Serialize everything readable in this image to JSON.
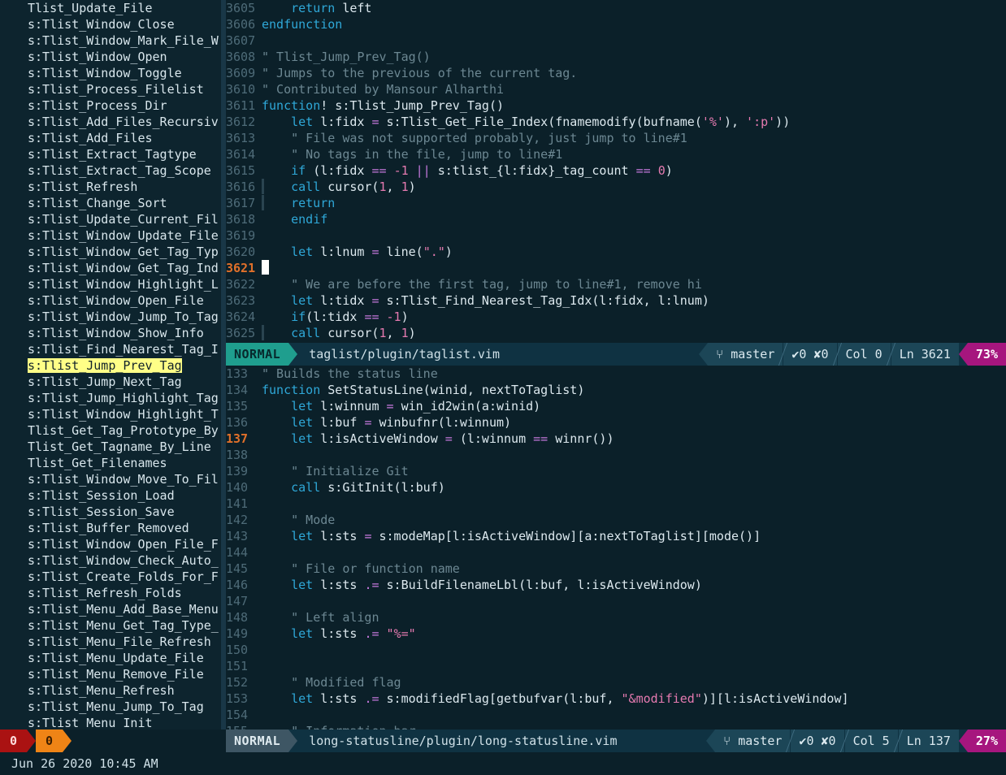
{
  "app": {
    "theme_bg": "#0b2029",
    "accent": "#1f9e8e",
    "highlight": "#ffff87",
    "percent_bg": "#a6167e"
  },
  "sidebar": {
    "name": "taglist",
    "scrollbar": {
      "name": "sidebar-scrollbar"
    },
    "selected_item": "s:Tlist_Jump_Prev_Tag",
    "items": [
      {
        "label": "Tlist_Update_File",
        "selected": false
      },
      {
        "label": "s:Tlist_Window_Close",
        "selected": false
      },
      {
        "label": "s:Tlist_Window_Mark_File_W",
        "selected": false
      },
      {
        "label": "s:Tlist_Window_Open",
        "selected": false
      },
      {
        "label": "s:Tlist_Window_Toggle",
        "selected": false
      },
      {
        "label": "s:Tlist_Process_Filelist",
        "selected": false
      },
      {
        "label": "s:Tlist_Process_Dir",
        "selected": false
      },
      {
        "label": "s:Tlist_Add_Files_Recursiv",
        "selected": false
      },
      {
        "label": "s:Tlist_Add_Files",
        "selected": false
      },
      {
        "label": "s:Tlist_Extract_Tagtype",
        "selected": false
      },
      {
        "label": "s:Tlist_Extract_Tag_Scope",
        "selected": false
      },
      {
        "label": "s:Tlist_Refresh",
        "selected": false
      },
      {
        "label": "s:Tlist_Change_Sort",
        "selected": false
      },
      {
        "label": "s:Tlist_Update_Current_Fil",
        "selected": false
      },
      {
        "label": "s:Tlist_Window_Update_File",
        "selected": false
      },
      {
        "label": "s:Tlist_Window_Get_Tag_Typ",
        "selected": false
      },
      {
        "label": "s:Tlist_Window_Get_Tag_Ind",
        "selected": false
      },
      {
        "label": "s:Tlist_Window_Highlight_L",
        "selected": false
      },
      {
        "label": "s:Tlist_Window_Open_File",
        "selected": false
      },
      {
        "label": "s:Tlist_Window_Jump_To_Tag",
        "selected": false
      },
      {
        "label": "s:Tlist_Window_Show_Info",
        "selected": false
      },
      {
        "label": "s:Tlist_Find_Nearest_Tag_I",
        "selected": false
      },
      {
        "label": "s:Tlist_Jump_Prev_Tag",
        "selected": true
      },
      {
        "label": "s:Tlist_Jump_Next_Tag",
        "selected": false
      },
      {
        "label": "s:Tlist_Jump_Highlight_Tag",
        "selected": false
      },
      {
        "label": "s:Tlist_Window_Highlight_T",
        "selected": false
      },
      {
        "label": "Tlist_Get_Tag_Prototype_By",
        "selected": false
      },
      {
        "label": "Tlist_Get_Tagname_By_Line",
        "selected": false
      },
      {
        "label": "Tlist_Get_Filenames",
        "selected": false
      },
      {
        "label": "s:Tlist_Window_Move_To_Fil",
        "selected": false
      },
      {
        "label": "s:Tlist_Session_Load",
        "selected": false
      },
      {
        "label": "s:Tlist_Session_Save",
        "selected": false
      },
      {
        "label": "s:Tlist_Buffer_Removed",
        "selected": false
      },
      {
        "label": "s:Tlist_Window_Open_File_F",
        "selected": false
      },
      {
        "label": "s:Tlist_Window_Check_Auto_",
        "selected": false
      },
      {
        "label": "s:Tlist_Create_Folds_For_F",
        "selected": false
      },
      {
        "label": "s:Tlist_Refresh_Folds",
        "selected": false
      },
      {
        "label": "s:Tlist_Menu_Add_Base_Menu",
        "selected": false
      },
      {
        "label": "s:Tlist_Menu_Get_Tag_Type_",
        "selected": false
      },
      {
        "label": "s:Tlist_Menu_File_Refresh",
        "selected": false
      },
      {
        "label": "s:Tlist_Menu_Update_File",
        "selected": false
      },
      {
        "label": "s:Tlist_Menu_Remove_File",
        "selected": false
      },
      {
        "label": "s:Tlist_Menu_Refresh",
        "selected": false
      },
      {
        "label": "s:Tlist_Menu_Jump_To_Tag",
        "selected": false
      },
      {
        "label": "s:Tlist_Menu_Init",
        "selected": false
      }
    ]
  },
  "top_pane": {
    "cursor_line": 3621,
    "lines": [
      {
        "n": "3605",
        "tokens": [
          {
            "t": "    ",
            "c": "pl"
          },
          {
            "t": "return",
            "c": "k"
          },
          {
            "t": " left",
            "c": "id"
          }
        ]
      },
      {
        "n": "3606",
        "tokens": [
          {
            "t": "endfunction",
            "c": "k"
          }
        ]
      },
      {
        "n": "3607",
        "tokens": []
      },
      {
        "n": "3608",
        "tokens": [
          {
            "t": "\" Tlist_Jump_Prev_Tag()",
            "c": "cm"
          }
        ]
      },
      {
        "n": "3609",
        "tokens": [
          {
            "t": "\" Jumps to the previous of the current tag.",
            "c": "cm"
          }
        ]
      },
      {
        "n": "3610",
        "tokens": [
          {
            "t": "\" Contributed by Mansour Alharthi",
            "c": "cm"
          }
        ]
      },
      {
        "n": "3611",
        "tokens": [
          {
            "t": "function",
            "c": "k"
          },
          {
            "t": "! s:Tlist_Jump_Prev_Tag()",
            "c": "id"
          }
        ]
      },
      {
        "n": "3612",
        "tokens": [
          {
            "t": "    ",
            "c": "pl"
          },
          {
            "t": "let",
            "c": "k"
          },
          {
            "t": " l:fidx ",
            "c": "id"
          },
          {
            "t": "=",
            "c": "op"
          },
          {
            "t": " s:Tlist_Get_File_Index(fnamemodify(bufname(",
            "c": "id"
          },
          {
            "t": "'%'",
            "c": "st"
          },
          {
            "t": "), ",
            "c": "id"
          },
          {
            "t": "':p'",
            "c": "st"
          },
          {
            "t": "))",
            "c": "id"
          }
        ]
      },
      {
        "n": "3613",
        "tokens": [
          {
            "t": "    ",
            "c": "pl"
          },
          {
            "t": "\" File was not supported probably, just jump to line#1",
            "c": "cm"
          }
        ]
      },
      {
        "n": "3614",
        "tokens": [
          {
            "t": "    ",
            "c": "pl"
          },
          {
            "t": "\" No tags in the file, jump to line#1",
            "c": "cm"
          }
        ]
      },
      {
        "n": "3615",
        "tokens": [
          {
            "t": "    ",
            "c": "pl"
          },
          {
            "t": "if",
            "c": "k"
          },
          {
            "t": " (l:fidx ",
            "c": "id"
          },
          {
            "t": "==",
            "c": "op"
          },
          {
            "t": " ",
            "c": "id"
          },
          {
            "t": "-1",
            "c": "nu"
          },
          {
            "t": " ",
            "c": "id"
          },
          {
            "t": "||",
            "c": "op"
          },
          {
            "t": " s:tlist_{l:fidx}_tag_count ",
            "c": "id"
          },
          {
            "t": "==",
            "c": "op"
          },
          {
            "t": " ",
            "c": "id"
          },
          {
            "t": "0",
            "c": "nu"
          },
          {
            "t": ")",
            "c": "id"
          }
        ]
      },
      {
        "n": "3616",
        "guide": true,
        "tokens": [
          {
            "t": "   ",
            "c": "pl"
          },
          {
            "t": "call",
            "c": "k"
          },
          {
            "t": " cursor(",
            "c": "id"
          },
          {
            "t": "1",
            "c": "nu"
          },
          {
            "t": ", ",
            "c": "id"
          },
          {
            "t": "1",
            "c": "nu"
          },
          {
            "t": ")",
            "c": "id"
          }
        ]
      },
      {
        "n": "3617",
        "guide": true,
        "tokens": [
          {
            "t": "   ",
            "c": "pl"
          },
          {
            "t": "return",
            "c": "k"
          }
        ]
      },
      {
        "n": "3618",
        "tokens": [
          {
            "t": "    ",
            "c": "pl"
          },
          {
            "t": "endif",
            "c": "k"
          }
        ]
      },
      {
        "n": "3619",
        "tokens": []
      },
      {
        "n": "3620",
        "tokens": [
          {
            "t": "    ",
            "c": "pl"
          },
          {
            "t": "let",
            "c": "k"
          },
          {
            "t": " l:lnum ",
            "c": "id"
          },
          {
            "t": "=",
            "c": "op"
          },
          {
            "t": " line(",
            "c": "id"
          },
          {
            "t": "\".\"",
            "c": "st"
          },
          {
            "t": ")",
            "c": "id"
          }
        ]
      },
      {
        "n": "3621",
        "cursor": true,
        "tokens": []
      },
      {
        "n": "3622",
        "tokens": [
          {
            "t": "    ",
            "c": "pl"
          },
          {
            "t": "\" We are before the first tag, jump to line#1, remove hi",
            "c": "cm"
          }
        ]
      },
      {
        "n": "3623",
        "tokens": [
          {
            "t": "    ",
            "c": "pl"
          },
          {
            "t": "let",
            "c": "k"
          },
          {
            "t": " l:tidx ",
            "c": "id"
          },
          {
            "t": "=",
            "c": "op"
          },
          {
            "t": " s:Tlist_Find_Nearest_Tag_Idx(l:fidx, l:lnum)",
            "c": "id"
          }
        ]
      },
      {
        "n": "3624",
        "tokens": [
          {
            "t": "    ",
            "c": "pl"
          },
          {
            "t": "if",
            "c": "k"
          },
          {
            "t": "(l:tidx ",
            "c": "id"
          },
          {
            "t": "==",
            "c": "op"
          },
          {
            "t": " ",
            "c": "id"
          },
          {
            "t": "-1",
            "c": "nu"
          },
          {
            "t": ")",
            "c": "id"
          }
        ]
      },
      {
        "n": "3625",
        "guide": true,
        "tokens": [
          {
            "t": "   ",
            "c": "pl"
          },
          {
            "t": "call",
            "c": "k"
          },
          {
            "t": " cursor(",
            "c": "id"
          },
          {
            "t": "1",
            "c": "nu"
          },
          {
            "t": ", ",
            "c": "id"
          },
          {
            "t": "1",
            "c": "nu"
          },
          {
            "t": ")",
            "c": "id"
          }
        ]
      }
    ]
  },
  "top_status": {
    "mode": "NORMAL",
    "file": "taglist/plugin/taglist.vim",
    "git_icon": "git-branch-icon",
    "branch": "master",
    "ok_icon": "check-icon",
    "ok_count": "0",
    "err_icon": "cross-icon",
    "err_count": "0",
    "col_label": "Col 0",
    "line_label": "Ln 3621",
    "percent": "73%"
  },
  "bottom_pane": {
    "cursor_line": 137,
    "lines": [
      {
        "n": "133",
        "tokens": [
          {
            "t": "\" Builds the status line",
            "c": "cm"
          }
        ]
      },
      {
        "n": "134",
        "tokens": [
          {
            "t": "function",
            "c": "k"
          },
          {
            "t": " SetStatusLine(winid, nextToTaglist)",
            "c": "id"
          }
        ]
      },
      {
        "n": "135",
        "tokens": [
          {
            "t": "    ",
            "c": "pl"
          },
          {
            "t": "let",
            "c": "k"
          },
          {
            "t": " l:winnum ",
            "c": "id"
          },
          {
            "t": "=",
            "c": "op"
          },
          {
            "t": " win_id2win(a:winid)",
            "c": "id"
          }
        ]
      },
      {
        "n": "136",
        "tokens": [
          {
            "t": "    ",
            "c": "pl"
          },
          {
            "t": "let",
            "c": "k"
          },
          {
            "t": " l:buf ",
            "c": "id"
          },
          {
            "t": "=",
            "c": "op"
          },
          {
            "t": " winbufnr(l:winnum)",
            "c": "id"
          }
        ]
      },
      {
        "n": "137",
        "cursor": true,
        "tokens": [
          {
            "t": "    ",
            "c": "pl"
          },
          {
            "t": "let",
            "c": "k"
          },
          {
            "t": " l:isActiveWindow ",
            "c": "id"
          },
          {
            "t": "=",
            "c": "op"
          },
          {
            "t": " (l:winnum ",
            "c": "id"
          },
          {
            "t": "==",
            "c": "op"
          },
          {
            "t": " winnr())",
            "c": "id"
          }
        ]
      },
      {
        "n": "138",
        "tokens": []
      },
      {
        "n": "139",
        "tokens": [
          {
            "t": "    ",
            "c": "pl"
          },
          {
            "t": "\" Initialize Git",
            "c": "cm"
          }
        ]
      },
      {
        "n": "140",
        "tokens": [
          {
            "t": "    ",
            "c": "pl"
          },
          {
            "t": "call",
            "c": "k"
          },
          {
            "t": " s:GitInit(l:buf)",
            "c": "id"
          }
        ]
      },
      {
        "n": "141",
        "tokens": []
      },
      {
        "n": "142",
        "tokens": [
          {
            "t": "    ",
            "c": "pl"
          },
          {
            "t": "\" Mode",
            "c": "cm"
          }
        ]
      },
      {
        "n": "143",
        "tokens": [
          {
            "t": "    ",
            "c": "pl"
          },
          {
            "t": "let",
            "c": "k"
          },
          {
            "t": " l:sts ",
            "c": "id"
          },
          {
            "t": "=",
            "c": "op"
          },
          {
            "t": " s:modeMap[l:isActiveWindow][a:nextToTaglist][mode()]",
            "c": "id"
          }
        ]
      },
      {
        "n": "144",
        "tokens": []
      },
      {
        "n": "145",
        "tokens": [
          {
            "t": "    ",
            "c": "pl"
          },
          {
            "t": "\" File or function name",
            "c": "cm"
          }
        ]
      },
      {
        "n": "146",
        "tokens": [
          {
            "t": "    ",
            "c": "pl"
          },
          {
            "t": "let",
            "c": "k"
          },
          {
            "t": " l:sts ",
            "c": "id"
          },
          {
            "t": ".=",
            "c": "op"
          },
          {
            "t": " s:BuildFilenameLbl(l:buf, l:isActiveWindow)",
            "c": "id"
          }
        ]
      },
      {
        "n": "147",
        "tokens": []
      },
      {
        "n": "148",
        "tokens": [
          {
            "t": "    ",
            "c": "pl"
          },
          {
            "t": "\" Left align",
            "c": "cm"
          }
        ]
      },
      {
        "n": "149",
        "tokens": [
          {
            "t": "    ",
            "c": "pl"
          },
          {
            "t": "let",
            "c": "k"
          },
          {
            "t": " l:sts ",
            "c": "id"
          },
          {
            "t": ".=",
            "c": "op"
          },
          {
            "t": " ",
            "c": "id"
          },
          {
            "t": "\"%=\"",
            "c": "st"
          }
        ]
      },
      {
        "n": "150",
        "tokens": []
      },
      {
        "n": "151",
        "tokens": []
      },
      {
        "n": "152",
        "tokens": [
          {
            "t": "    ",
            "c": "pl"
          },
          {
            "t": "\" Modified flag",
            "c": "cm"
          }
        ]
      },
      {
        "n": "153",
        "tokens": [
          {
            "t": "    ",
            "c": "pl"
          },
          {
            "t": "let",
            "c": "k"
          },
          {
            "t": " l:sts ",
            "c": "id"
          },
          {
            "t": ".=",
            "c": "op"
          },
          {
            "t": " s:modifiedFlag[getbufvar(l:buf, ",
            "c": "id"
          },
          {
            "t": "\"&modified\"",
            "c": "st"
          },
          {
            "t": ")][l:isActiveWindow]",
            "c": "id"
          }
        ]
      },
      {
        "n": "154",
        "tokens": []
      },
      {
        "n": "155",
        "tokens": [
          {
            "t": "    ",
            "c": "pl"
          },
          {
            "t": "\" Information bar",
            "c": "cm"
          }
        ]
      }
    ]
  },
  "bottom_status": {
    "error_icon": "error-count-badge",
    "error_count": "0",
    "warning_icon": "warning-count-badge",
    "warning_count": "0",
    "datetime": "Jun 26 2020 10:45 AM",
    "mode": "NORMAL",
    "file": "long-statusline/plugin/long-statusline.vim",
    "git_icon": "git-branch-icon",
    "branch": "master",
    "ok_icon": "check-icon",
    "ok_count": "0",
    "err_icon": "cross-icon",
    "err_count": "0",
    "col_label": "Col 5",
    "line_label": "Ln 137",
    "percent": "27%"
  }
}
